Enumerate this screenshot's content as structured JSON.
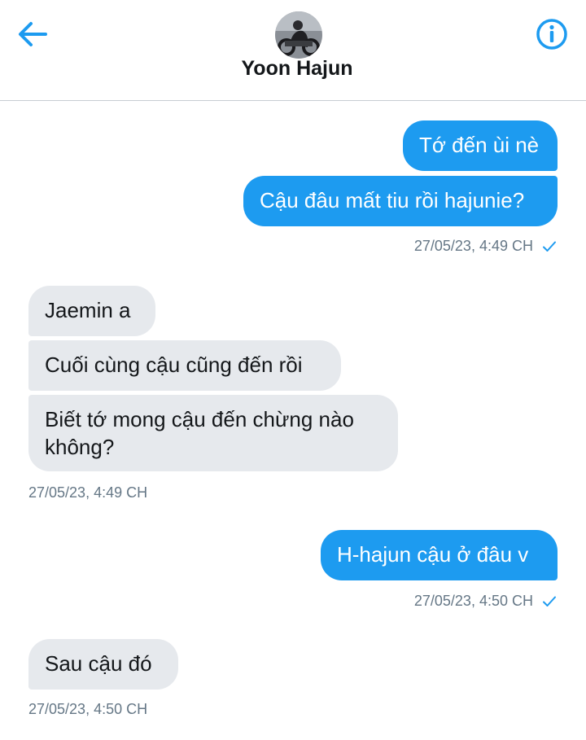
{
  "header": {
    "contact_name": "Yoon Hajun",
    "back_icon": "arrow-left-icon",
    "info_icon": "info-icon",
    "accent_color": "#1d9bf0"
  },
  "messages": [
    {
      "direction": "out",
      "text": "Tớ đến ùi nè"
    },
    {
      "direction": "out",
      "text": "Cậu đâu mất tiu rồi hajunie?"
    },
    {
      "direction": "in",
      "text": "Jaemin a"
    },
    {
      "direction": "in",
      "text": "Cuối cùng cậu cũng đến rồi"
    },
    {
      "direction": "in",
      "text": "Biết tớ mong cậu đến chừng nào không?"
    },
    {
      "direction": "out",
      "text": "H-hajun cậu ở đâu v"
    },
    {
      "direction": "in",
      "text": "Sau cậu đó"
    }
  ],
  "timestamps": [
    {
      "text": "27/05/23, 4:49 CH",
      "read": true
    },
    {
      "text": "27/05/23, 4:49 CH",
      "read": false
    },
    {
      "text": "27/05/23, 4:50 CH",
      "read": true
    },
    {
      "text": "27/05/23, 4:50 CH",
      "read": false
    }
  ]
}
